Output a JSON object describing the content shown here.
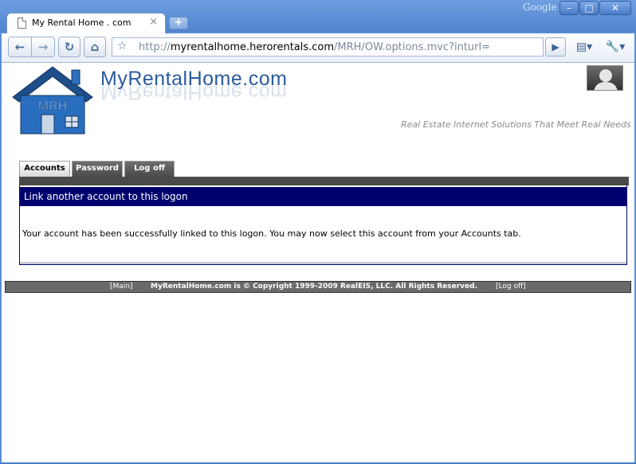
{
  "browser": {
    "tab_title": "My Rental Home . com",
    "tab_close": "×",
    "new_tab": "+",
    "brand": "Google",
    "url_prefix": "http://",
    "url_host": "myrentalhome.herorentals.com",
    "url_path": "/MRH/OW.options.mvc?inturl=",
    "window_buttons": {
      "minimize": "–",
      "maximize": "□",
      "close": "✕"
    },
    "nav": {
      "back": "←",
      "forward": "→",
      "reload": "↻",
      "home": "⌂",
      "star": "☆",
      "go": "▶",
      "page": "▤▾",
      "wrench": "🔧▾"
    }
  },
  "site": {
    "logo_text": "MRH",
    "title": "MyRentalHome.com",
    "tagline": "Real Estate Internet Solutions That Meet Real Needs"
  },
  "tabs": [
    {
      "label": "Accounts"
    },
    {
      "label": "Password"
    },
    {
      "label": "Log off"
    }
  ],
  "panel": {
    "heading": "Link another account to this logon",
    "message": "Your account has been successfully linked to this logon. You may now select this account from your Accounts tab."
  },
  "footer": {
    "main_link": "[Main]",
    "copyright": "MyRentalHome.com is © Copyright 1999-2009 RealEIS, LLC. All Rights Reserved.",
    "logoff_link": "[Log off]"
  },
  "colors": {
    "panel_header": "#00006e",
    "brand_blue": "#2a5b9c",
    "titlebar": "#5b8fd6"
  }
}
